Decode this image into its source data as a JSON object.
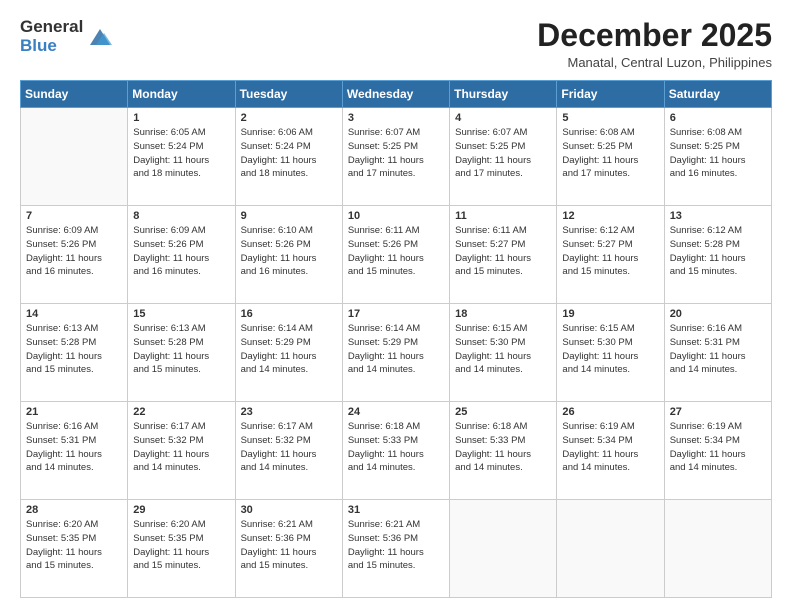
{
  "header": {
    "logo_general": "General",
    "logo_blue": "Blue",
    "month_title": "December 2025",
    "subtitle": "Manatal, Central Luzon, Philippines"
  },
  "days_of_week": [
    "Sunday",
    "Monday",
    "Tuesday",
    "Wednesday",
    "Thursday",
    "Friday",
    "Saturday"
  ],
  "weeks": [
    [
      {
        "day": "",
        "info": ""
      },
      {
        "day": "1",
        "info": "Sunrise: 6:05 AM\nSunset: 5:24 PM\nDaylight: 11 hours\nand 18 minutes."
      },
      {
        "day": "2",
        "info": "Sunrise: 6:06 AM\nSunset: 5:24 PM\nDaylight: 11 hours\nand 18 minutes."
      },
      {
        "day": "3",
        "info": "Sunrise: 6:07 AM\nSunset: 5:25 PM\nDaylight: 11 hours\nand 17 minutes."
      },
      {
        "day": "4",
        "info": "Sunrise: 6:07 AM\nSunset: 5:25 PM\nDaylight: 11 hours\nand 17 minutes."
      },
      {
        "day": "5",
        "info": "Sunrise: 6:08 AM\nSunset: 5:25 PM\nDaylight: 11 hours\nand 17 minutes."
      },
      {
        "day": "6",
        "info": "Sunrise: 6:08 AM\nSunset: 5:25 PM\nDaylight: 11 hours\nand 16 minutes."
      }
    ],
    [
      {
        "day": "7",
        "info": "Sunrise: 6:09 AM\nSunset: 5:26 PM\nDaylight: 11 hours\nand 16 minutes."
      },
      {
        "day": "8",
        "info": "Sunrise: 6:09 AM\nSunset: 5:26 PM\nDaylight: 11 hours\nand 16 minutes."
      },
      {
        "day": "9",
        "info": "Sunrise: 6:10 AM\nSunset: 5:26 PM\nDaylight: 11 hours\nand 16 minutes."
      },
      {
        "day": "10",
        "info": "Sunrise: 6:11 AM\nSunset: 5:26 PM\nDaylight: 11 hours\nand 15 minutes."
      },
      {
        "day": "11",
        "info": "Sunrise: 6:11 AM\nSunset: 5:27 PM\nDaylight: 11 hours\nand 15 minutes."
      },
      {
        "day": "12",
        "info": "Sunrise: 6:12 AM\nSunset: 5:27 PM\nDaylight: 11 hours\nand 15 minutes."
      },
      {
        "day": "13",
        "info": "Sunrise: 6:12 AM\nSunset: 5:28 PM\nDaylight: 11 hours\nand 15 minutes."
      }
    ],
    [
      {
        "day": "14",
        "info": "Sunrise: 6:13 AM\nSunset: 5:28 PM\nDaylight: 11 hours\nand 15 minutes."
      },
      {
        "day": "15",
        "info": "Sunrise: 6:13 AM\nSunset: 5:28 PM\nDaylight: 11 hours\nand 15 minutes."
      },
      {
        "day": "16",
        "info": "Sunrise: 6:14 AM\nSunset: 5:29 PM\nDaylight: 11 hours\nand 14 minutes."
      },
      {
        "day": "17",
        "info": "Sunrise: 6:14 AM\nSunset: 5:29 PM\nDaylight: 11 hours\nand 14 minutes."
      },
      {
        "day": "18",
        "info": "Sunrise: 6:15 AM\nSunset: 5:30 PM\nDaylight: 11 hours\nand 14 minutes."
      },
      {
        "day": "19",
        "info": "Sunrise: 6:15 AM\nSunset: 5:30 PM\nDaylight: 11 hours\nand 14 minutes."
      },
      {
        "day": "20",
        "info": "Sunrise: 6:16 AM\nSunset: 5:31 PM\nDaylight: 11 hours\nand 14 minutes."
      }
    ],
    [
      {
        "day": "21",
        "info": "Sunrise: 6:16 AM\nSunset: 5:31 PM\nDaylight: 11 hours\nand 14 minutes."
      },
      {
        "day": "22",
        "info": "Sunrise: 6:17 AM\nSunset: 5:32 PM\nDaylight: 11 hours\nand 14 minutes."
      },
      {
        "day": "23",
        "info": "Sunrise: 6:17 AM\nSunset: 5:32 PM\nDaylight: 11 hours\nand 14 minutes."
      },
      {
        "day": "24",
        "info": "Sunrise: 6:18 AM\nSunset: 5:33 PM\nDaylight: 11 hours\nand 14 minutes."
      },
      {
        "day": "25",
        "info": "Sunrise: 6:18 AM\nSunset: 5:33 PM\nDaylight: 11 hours\nand 14 minutes."
      },
      {
        "day": "26",
        "info": "Sunrise: 6:19 AM\nSunset: 5:34 PM\nDaylight: 11 hours\nand 14 minutes."
      },
      {
        "day": "27",
        "info": "Sunrise: 6:19 AM\nSunset: 5:34 PM\nDaylight: 11 hours\nand 14 minutes."
      }
    ],
    [
      {
        "day": "28",
        "info": "Sunrise: 6:20 AM\nSunset: 5:35 PM\nDaylight: 11 hours\nand 15 minutes."
      },
      {
        "day": "29",
        "info": "Sunrise: 6:20 AM\nSunset: 5:35 PM\nDaylight: 11 hours\nand 15 minutes."
      },
      {
        "day": "30",
        "info": "Sunrise: 6:21 AM\nSunset: 5:36 PM\nDaylight: 11 hours\nand 15 minutes."
      },
      {
        "day": "31",
        "info": "Sunrise: 6:21 AM\nSunset: 5:36 PM\nDaylight: 11 hours\nand 15 minutes."
      },
      {
        "day": "",
        "info": ""
      },
      {
        "day": "",
        "info": ""
      },
      {
        "day": "",
        "info": ""
      }
    ]
  ]
}
